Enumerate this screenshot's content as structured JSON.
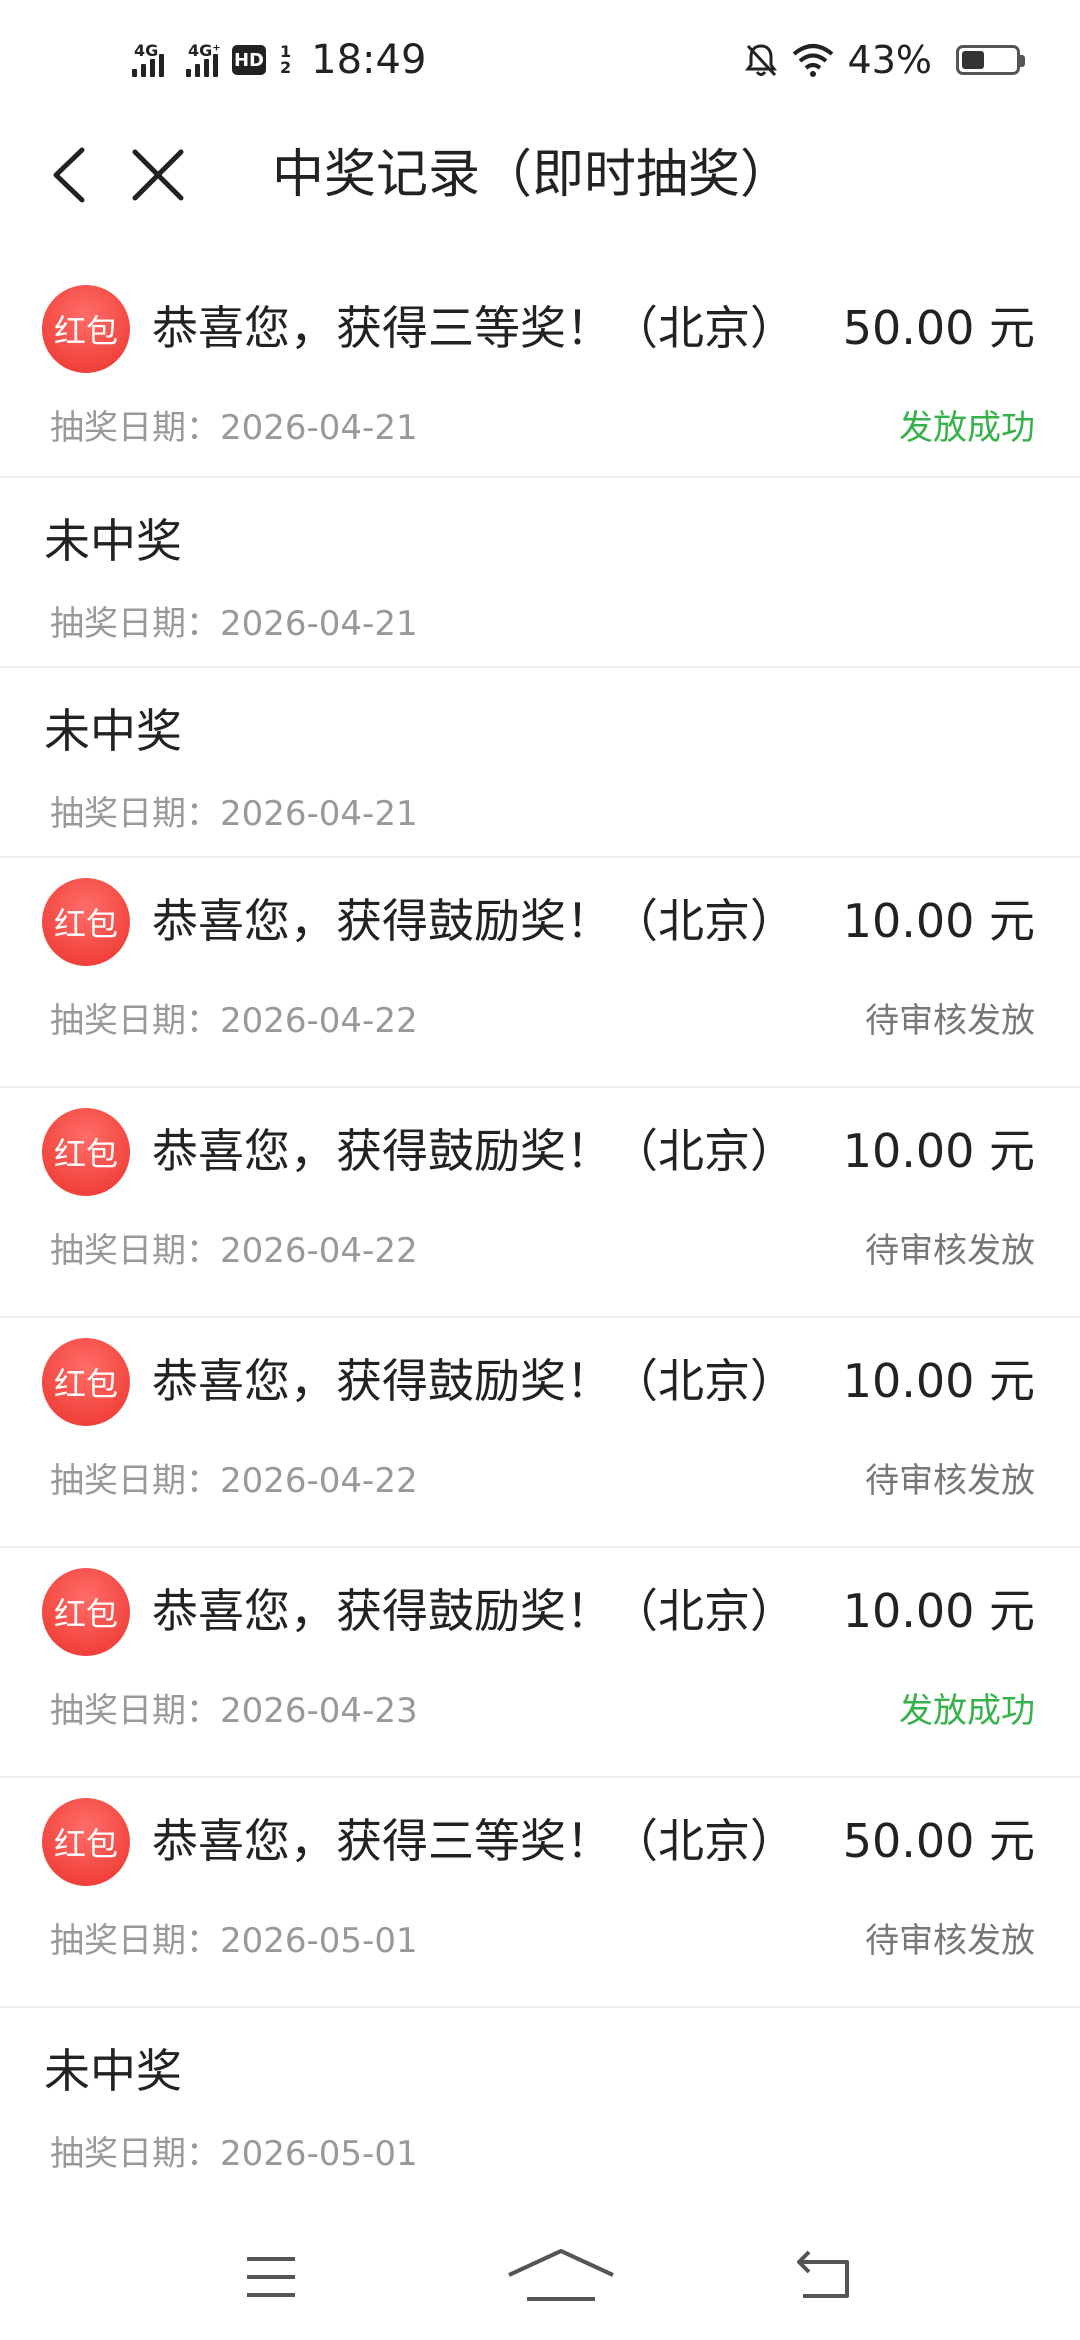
{
  "status_bar": {
    "signal1_label": "4G",
    "signal2_label": "4G⁺",
    "hd_label": "HD",
    "hd_top": "1",
    "hd_bottom": "2",
    "time": "18:49",
    "battery": "43%",
    "icons": [
      "bell-off-icon",
      "wifi-icon",
      "battery-icon"
    ]
  },
  "nav": {
    "title": "中奖记录（即时抽奖）",
    "icons": [
      "back-chevron-icon",
      "close-icon"
    ]
  },
  "badge_label": "红包",
  "colors": {
    "badge_red": "#f2443e",
    "success_green": "#36b24a",
    "muted": "#999999"
  },
  "records": [
    {
      "type": "won",
      "title": "恭喜您，获得三等奖！（北京）",
      "amount": "50.00 元",
      "date": "抽奖日期：2026-04-21",
      "status": "发放成功",
      "status_kind": "success"
    },
    {
      "type": "lost",
      "title": "未中奖",
      "date": "抽奖日期：2026-04-21"
    },
    {
      "type": "lost",
      "title": "未中奖",
      "date": "抽奖日期：2026-04-21"
    },
    {
      "type": "won",
      "title": "恭喜您，获得鼓励奖！（北京）",
      "amount": "10.00 元",
      "date": "抽奖日期：2026-04-22",
      "status": "待审核发放",
      "status_kind": "pending"
    },
    {
      "type": "won",
      "title": "恭喜您，获得鼓励奖！（北京）",
      "amount": "10.00 元",
      "date": "抽奖日期：2026-04-22",
      "status": "待审核发放",
      "status_kind": "pending"
    },
    {
      "type": "won",
      "title": "恭喜您，获得鼓励奖！（北京）",
      "amount": "10.00 元",
      "date": "抽奖日期：2026-04-22",
      "status": "待审核发放",
      "status_kind": "pending"
    },
    {
      "type": "won",
      "title": "恭喜您，获得鼓励奖！（北京）",
      "amount": "10.00 元",
      "date": "抽奖日期：2026-04-23",
      "status": "发放成功",
      "status_kind": "success"
    },
    {
      "type": "won",
      "title": "恭喜您，获得三等奖！（北京）",
      "amount": "50.00 元",
      "date": "抽奖日期：2026-05-01",
      "status": "待审核发放",
      "status_kind": "pending"
    },
    {
      "type": "lost",
      "title": "未中奖",
      "date": "抽奖日期：2026-05-01"
    }
  ],
  "bottom_nav": {
    "icons": [
      "menu-icon",
      "home-icon",
      "back-icon"
    ]
  }
}
